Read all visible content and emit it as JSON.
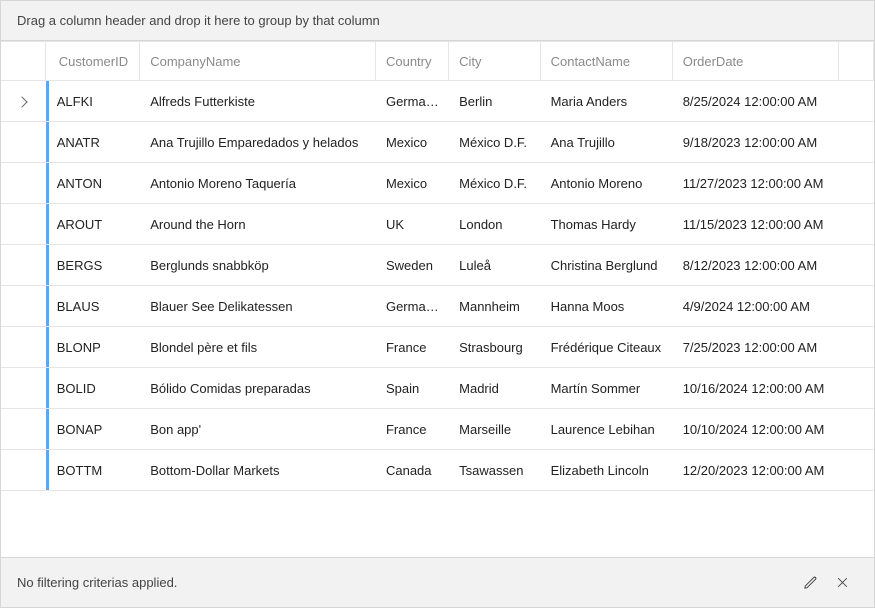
{
  "groupPanelText": "Drag a column header and drop it here to group by that column",
  "columns": {
    "customerId": "CustomerID",
    "companyName": "CompanyName",
    "country": "Country",
    "city": "City",
    "contactName": "ContactName",
    "orderDate": "OrderDate"
  },
  "rows": [
    {
      "customerId": "ALFKI",
      "companyName": "Alfreds Futterkiste",
      "country": "Germany",
      "city": "Berlin",
      "contactName": "Maria Anders",
      "orderDate": "8/25/2024 12:00:00 AM"
    },
    {
      "customerId": "ANATR",
      "companyName": "Ana Trujillo Emparedados y helados",
      "country": "Mexico",
      "city": "México D.F.",
      "contactName": "Ana Trujillo",
      "orderDate": "9/18/2023 12:00:00 AM"
    },
    {
      "customerId": "ANTON",
      "companyName": "Antonio Moreno Taquería",
      "country": "Mexico",
      "city": "México D.F.",
      "contactName": "Antonio Moreno",
      "orderDate": "11/27/2023 12:00:00 AM"
    },
    {
      "customerId": "AROUT",
      "companyName": "Around the Horn",
      "country": "UK",
      "city": "London",
      "contactName": "Thomas Hardy",
      "orderDate": "11/15/2023 12:00:00 AM"
    },
    {
      "customerId": "BERGS",
      "companyName": "Berglunds snabbköp",
      "country": "Sweden",
      "city": "Luleå",
      "contactName": "Christina Berglund",
      "orderDate": "8/12/2023 12:00:00 AM"
    },
    {
      "customerId": "BLAUS",
      "companyName": "Blauer See Delikatessen",
      "country": "Germany",
      "city": "Mannheim",
      "contactName": "Hanna Moos",
      "orderDate": "4/9/2024 12:00:00 AM"
    },
    {
      "customerId": "BLONP",
      "companyName": "Blondel père et fils",
      "country": "France",
      "city": "Strasbourg",
      "contactName": "Frédérique Citeaux",
      "orderDate": "7/25/2023 12:00:00 AM"
    },
    {
      "customerId": "BOLID",
      "companyName": "Bólido Comidas preparadas",
      "country": "Spain",
      "city": "Madrid",
      "contactName": "Martín Sommer",
      "orderDate": "10/16/2024 12:00:00 AM"
    },
    {
      "customerId": "BONAP",
      "companyName": "Bon app'",
      "country": "France",
      "city": "Marseille",
      "contactName": "Laurence Lebihan",
      "orderDate": "10/10/2024 12:00:00 AM"
    },
    {
      "customerId": "BOTTM",
      "companyName": "Bottom-Dollar Markets",
      "country": "Canada",
      "city": "Tsawassen",
      "contactName": "Elizabeth Lincoln",
      "orderDate": "12/20/2023 12:00:00 AM"
    }
  ],
  "footer": {
    "filterText": "No filtering criterias applied."
  }
}
